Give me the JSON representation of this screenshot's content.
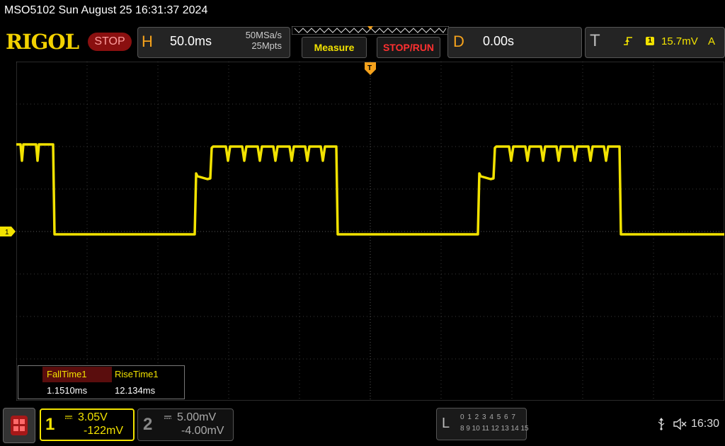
{
  "header": {
    "title": "MSO5102  Sun August 25 16:31:37 2024"
  },
  "toolbar": {
    "logo": "RIGOL",
    "run_state": "STOP",
    "horizontal": {
      "letter": "H",
      "timebase": "50.0ms",
      "sample_rate": "50MSa/s",
      "memory_depth": "25Mpts"
    },
    "measure_label": "Measure",
    "stop_run_label": "STOP/RUN",
    "delay": {
      "letter": "D",
      "value": "0.00s"
    },
    "trigger": {
      "letter": "T",
      "source": "1",
      "level": "15.7mV",
      "mode": "A"
    }
  },
  "markers": {
    "ch1_marker": "1",
    "trigger_marker": "T"
  },
  "measurements": {
    "headers": [
      "FallTime1",
      "RiseTime1"
    ],
    "values": [
      "1.1510ms",
      "12.134ms"
    ]
  },
  "channels": {
    "ch1": {
      "number": "1",
      "scale": "3.05V",
      "offset": "-122mV"
    },
    "ch2": {
      "number": "2",
      "scale": "5.00mV",
      "offset": "-4.00mV"
    }
  },
  "logic_analyzer": {
    "label": "L",
    "row1": "0 1 2 3   4 5 6 7",
    "row2": "8 9 10 11  12 13 14 15"
  },
  "status": {
    "time": "16:30"
  },
  "colors": {
    "ch1": "#f2e200",
    "accent_orange": "#f5a21c",
    "stop_red": "#ff3030",
    "grid": "#444444"
  }
}
